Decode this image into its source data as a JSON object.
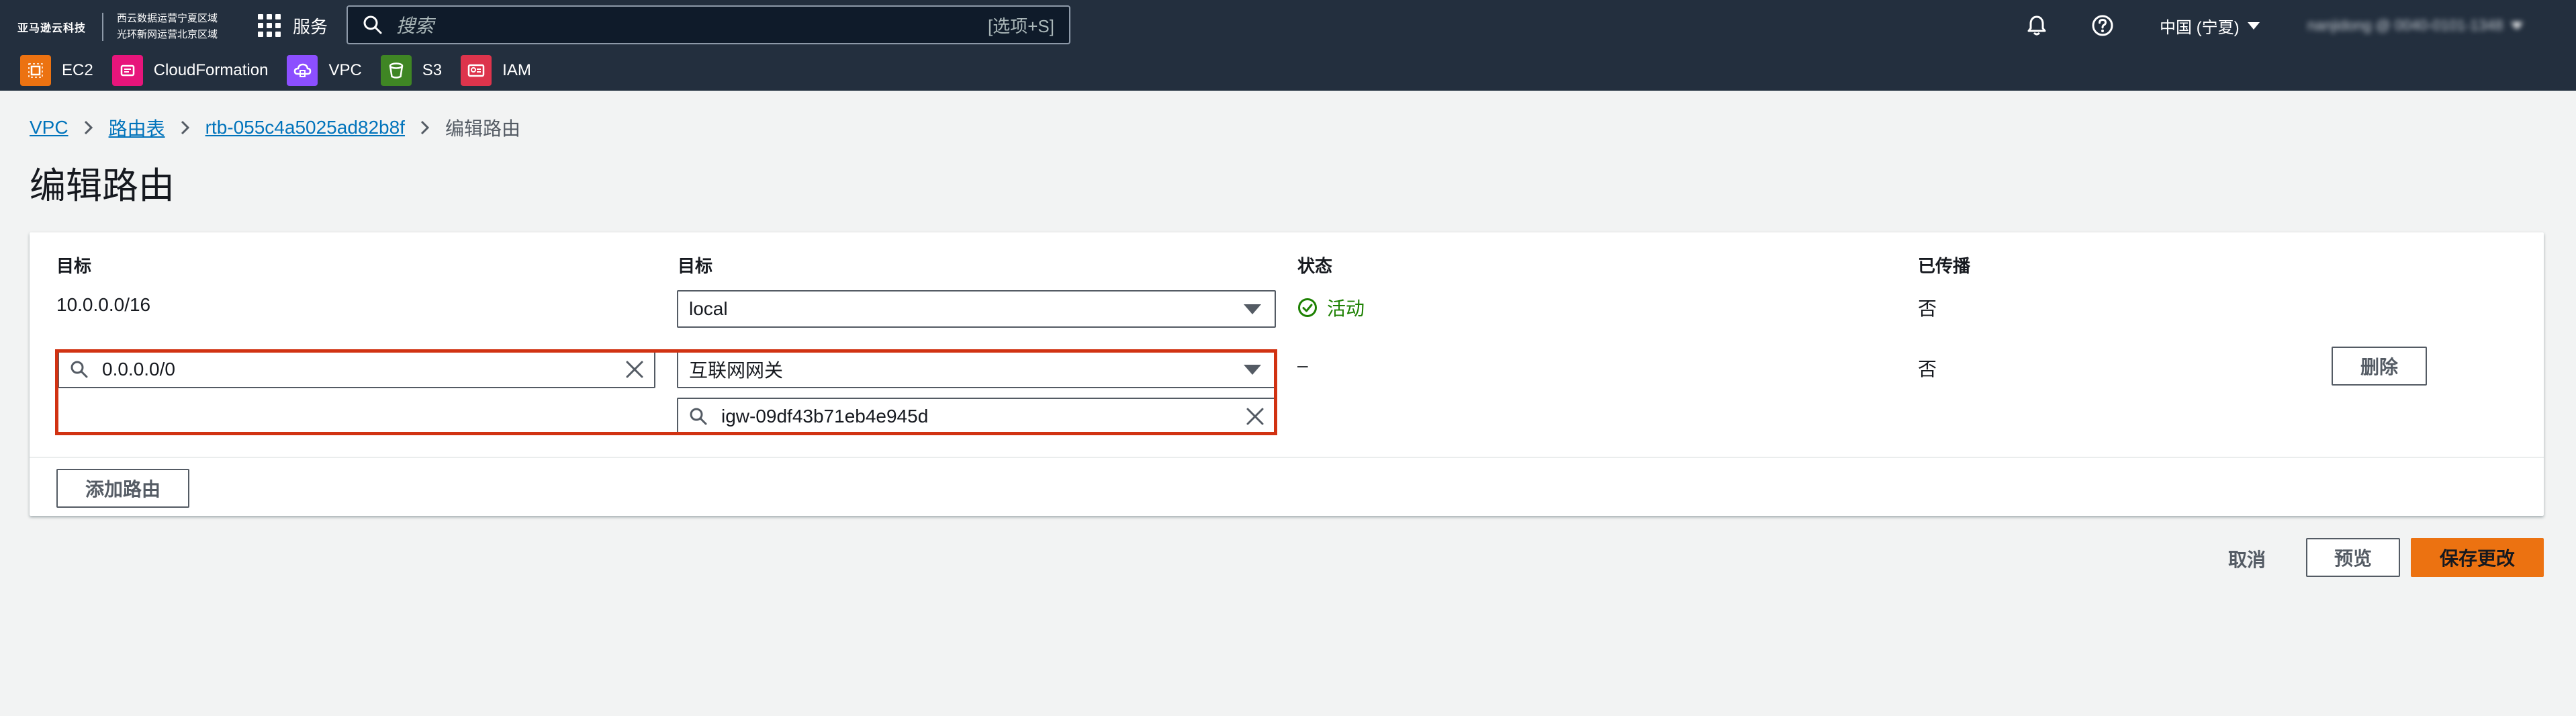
{
  "nav": {
    "brand_name": "亚马逊云科技",
    "brand_sub_line1": "西云数据运营宁夏区域",
    "brand_sub_line2": "光环新网运营北京区域",
    "services_label": "服务",
    "search_placeholder": "搜索",
    "search_shortcut": "[选项+S]",
    "region_label": "中国 (宁夏)",
    "account_label": "nanjidong @ 0040-0101-1348"
  },
  "favorites": [
    {
      "label": "EC2",
      "color": "#ec7211",
      "icon": "ec2-icon"
    },
    {
      "label": "CloudFormation",
      "color": "#e7157b",
      "icon": "cloudformation-icon"
    },
    {
      "label": "VPC",
      "color": "#8c4fff",
      "icon": "vpc-icon"
    },
    {
      "label": "S3",
      "color": "#3f8624",
      "icon": "s3-icon"
    },
    {
      "label": "IAM",
      "color": "#dd344c",
      "icon": "iam-icon"
    }
  ],
  "breadcrumb": {
    "items": [
      "VPC",
      "路由表",
      "rtb-055c4a5025ad82b8f"
    ],
    "current": "编辑路由"
  },
  "page_title": "编辑路由",
  "table": {
    "headers": {
      "destination": "目标",
      "target": "目标",
      "status": "状态",
      "propagated": "已传播"
    },
    "rows": [
      {
        "destination": "10.0.0.0/16",
        "target_type": "local",
        "target_value": "",
        "status": "活动",
        "propagated": "否",
        "removable": false
      },
      {
        "destination": "0.0.0.0/0",
        "target_type": "互联网网关",
        "target_value": "igw-09df43b71eb4e945d",
        "status": "–",
        "propagated": "否",
        "removable": true,
        "remove_label": "删除"
      }
    ],
    "add_route_label": "添加路由"
  },
  "actions": {
    "cancel_label": "取消",
    "preview_label": "预览",
    "save_label": "保存更改"
  },
  "colors": {
    "nav_bg": "#232f3e",
    "primary": "#ec7211",
    "link": "#0073bb",
    "success": "#1d8102",
    "highlight": "#d13212"
  }
}
